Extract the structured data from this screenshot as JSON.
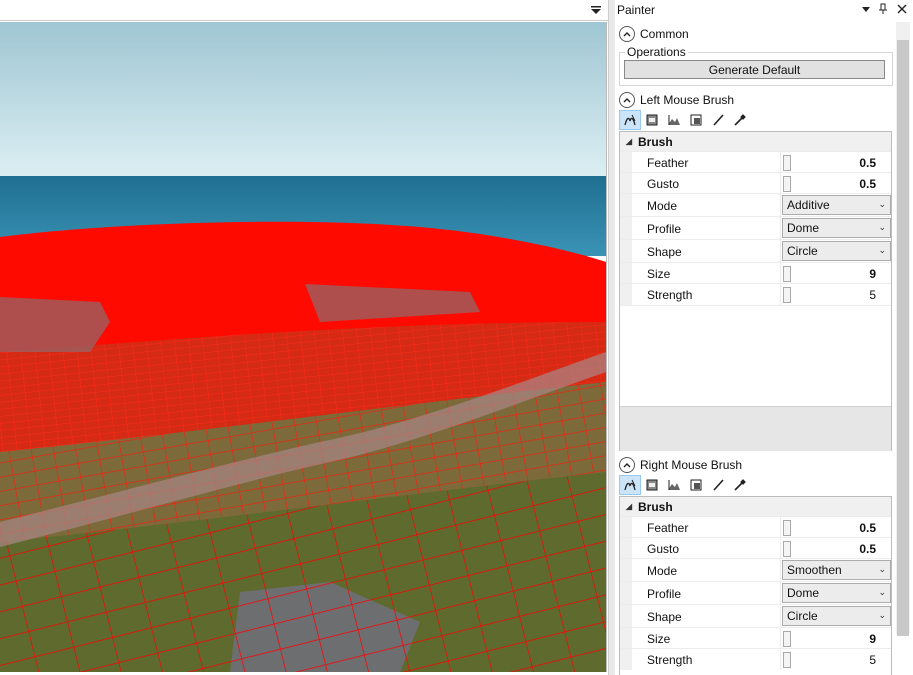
{
  "panel": {
    "title": "Painter",
    "menu_arrow": "▾",
    "pin": "📌",
    "close": "✕"
  },
  "common": {
    "header": "Common",
    "operations_label": "Operations",
    "generate_label": "Generate Default"
  },
  "left_brush": {
    "header": "Left Mouse Brush",
    "category": "Brush",
    "feather_label": "Feather",
    "feather_value": "0.5",
    "gusto_label": "Gusto",
    "gusto_value": "0.5",
    "mode_label": "Mode",
    "mode_value": "Additive",
    "profile_label": "Profile",
    "profile_value": "Dome",
    "shape_label": "Shape",
    "shape_value": "Circle",
    "size_label": "Size",
    "size_value": "9",
    "strength_label": "Strength",
    "strength_value": "5"
  },
  "right_brush": {
    "header": "Right Mouse Brush",
    "category": "Brush",
    "feather_label": "Feather",
    "feather_value": "0.5",
    "gusto_label": "Gusto",
    "gusto_value": "0.5",
    "mode_label": "Mode",
    "mode_value": "Smoothen",
    "profile_label": "Profile",
    "profile_value": "Dome",
    "shape_label": "Shape",
    "shape_value": "Circle",
    "size_label": "Size",
    "size_value": "9",
    "strength_label": "Strength",
    "strength_value": "5"
  },
  "tool_icons": [
    "height-brush-icon",
    "texture-brush-icon",
    "terrain-icon",
    "decal-icon",
    "paint-brush-icon",
    "eyedropper-icon"
  ],
  "colors": {
    "wireframe": "#ff0000",
    "sky": "#a9cdd8",
    "sea": "#2c7fa0",
    "accent_selected": "#cce4f7"
  }
}
